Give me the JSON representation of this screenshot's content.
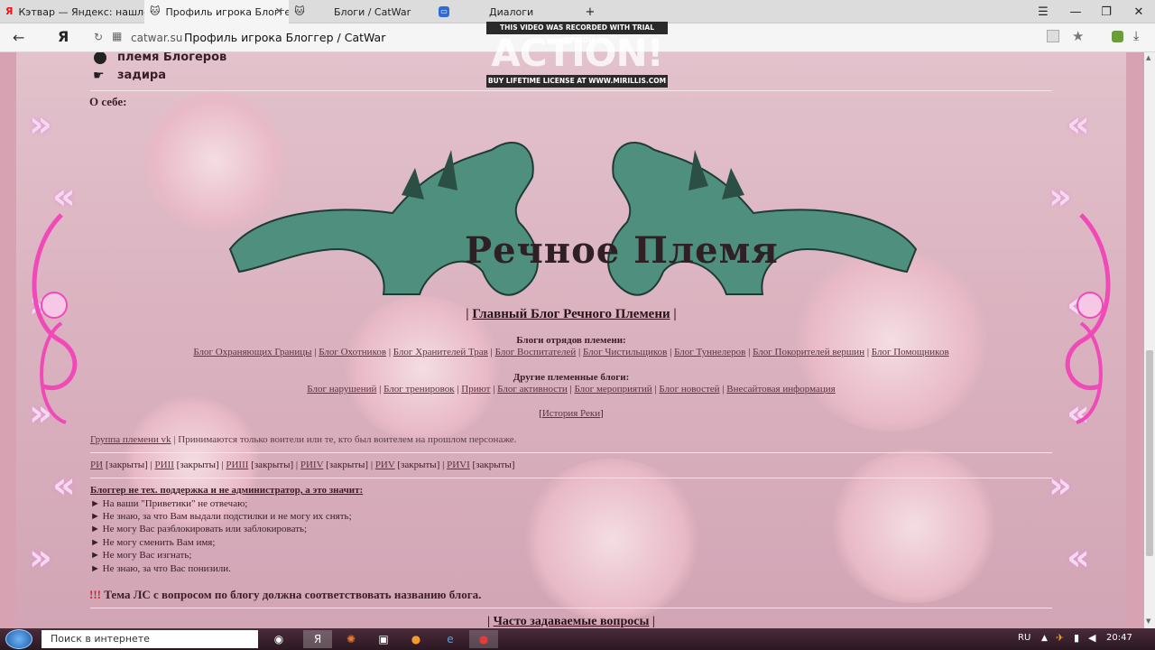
{
  "tabs": [
    {
      "title": "Кэтвар — Яндекс: нашлось",
      "icon": "Я"
    },
    {
      "title": "Профиль игрока Блоггер",
      "icon": "🐱"
    },
    {
      "title": "Блоги / CatWar",
      "icon": "🐱"
    },
    {
      "title": "Диалоги",
      "icon": "💬"
    }
  ],
  "addressbar": {
    "yandex_logo": "Я",
    "url": "catwar.su",
    "page_title": "Профиль игрока Блоггер / CatWar"
  },
  "watermark": {
    "top": "THIS VIDEO WAS RECORDED WITH TRIAL VERSION",
    "logo": "ACTION!",
    "bottom": "BUY LIFETIME LICENSE AT WWW.MIRILLIS.COM"
  },
  "profile": {
    "clan": "племя Блогеров",
    "trait": "задира",
    "about_label": "О себе:"
  },
  "banner": {
    "title": "Речное Племя"
  },
  "main_blog": {
    "pipe_left": "|",
    "label": "Главный Блог Речного Племени",
    "pipe_right": "|"
  },
  "squad_blogs": {
    "heading": "Блоги отрядов племени:",
    "links": [
      "Блог Охраняющих Границы",
      "Блог Охотников",
      "Блог Хранителей Трав",
      "Блог Воспитателей",
      "Блог Чистильщиков",
      "Блог Туннелеров",
      "Блог Покорителей вершин",
      "Блог Помощников"
    ]
  },
  "other_blogs": {
    "heading": "Другие племенные блоги:",
    "links": [
      "Блог нарушений",
      "Блог тренировок",
      "Приют",
      "Блог активности",
      "Блог мероприятий",
      "Блог новостей",
      "Внесайтовая информация"
    ]
  },
  "history": {
    "bracket_open": "[",
    "label": "История Реки",
    "bracket_close": "]"
  },
  "vk": {
    "link": "Группа племени vk",
    "text": " | Принимаются только воители или те, кто был воителем на прошлом персонаже."
  },
  "closed_blogs": [
    {
      "name": "РИ",
      "status": " [закрыты]"
    },
    {
      "name": "РИII",
      "status": " [закрыты]"
    },
    {
      "name": "РИIII",
      "status": " [закрыты]"
    },
    {
      "name": "РИIV",
      "status": " [закрыты]"
    },
    {
      "name": "РИV",
      "status": " [закрыты]"
    },
    {
      "name": "РИVI",
      "status": " [закрыты]"
    }
  ],
  "notice": {
    "heading": "Блоггер не тех. поддержка и не администратор, а это значит:",
    "items": [
      "► На ваши \"Приветики\" не отвечаю;",
      "► Не знаю, за что Вам выдали подстилки и не могу их снять;",
      "► Не могу Вас разблокировать или заблокировать;",
      "► Не могу сменить Вам имя;",
      "► Не могу Вас изгнать;",
      "► Не знаю, за что Вас понизили."
    ],
    "warning_marks": "!!!",
    "warning": " Тема ЛС с вопросом по блогу должна соответствовать названию блога."
  },
  "faq": {
    "pipe_left": "|",
    "label": "Часто задаваемые вопросы",
    "pipe_right": "|"
  },
  "taskbar": {
    "search_placeholder": "Поиск в интернете",
    "lang": "RU",
    "time": "20:47"
  },
  "colors": {
    "accent_pink": "#e94fb0",
    "cat_green": "#4f8f7d",
    "page_text": "#3a1d27"
  }
}
